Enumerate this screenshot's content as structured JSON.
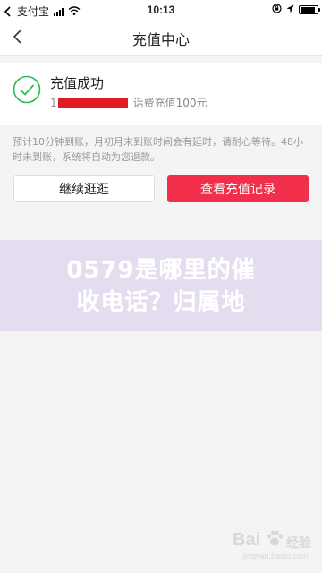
{
  "status_bar": {
    "back_app": "支付宝",
    "time": "10:13",
    "battery_level": 0.9
  },
  "nav": {
    "title": "充值中心"
  },
  "result": {
    "title": "充值成功",
    "phone_prefix": "1",
    "detail": "话费充值100元"
  },
  "notice": "预计10分钟到账，月初月末到账时间会有延时，请耐心等待。48小时未到账，系统将自动为您退款。",
  "buttons": {
    "continue_label": "继续逛逛",
    "records_label": "查看充值记录"
  },
  "overlay": {
    "line1": "0579是哪里的催",
    "line2": "收电话？归属地"
  },
  "watermark": {
    "main": "Bai",
    "sub": "经验",
    "url": "jingyan.baidu.com"
  },
  "colors": {
    "accent": "#f12f4b",
    "success": "#2dbb55",
    "redaction": "#e11b23"
  }
}
